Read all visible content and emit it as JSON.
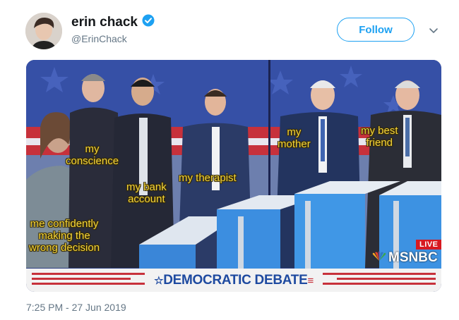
{
  "author": {
    "display_name": "erin chack",
    "handle": "@ErinChack",
    "verified": true
  },
  "actions": {
    "follow_label": "Follow"
  },
  "icons": {
    "verified": "verified-badge-icon",
    "more": "chevron-down-icon"
  },
  "image": {
    "captions": [
      "my\nconscience",
      "my bank\naccount",
      "my therapist",
      "my\nmother",
      "my best\nfriend",
      "me confidently\nmaking the\nwrong decision"
    ],
    "live_label": "LIVE",
    "network_label": "MSNBC",
    "banner_text": "DEMOCRATIC DEBATE"
  },
  "timestamp": "7:25 PM - 27 Jun 2019",
  "colors": {
    "accent": "#1da1f2",
    "caption": "#f2d33b",
    "banner_text": "#1e4aa0",
    "live_badge": "#d71920"
  }
}
